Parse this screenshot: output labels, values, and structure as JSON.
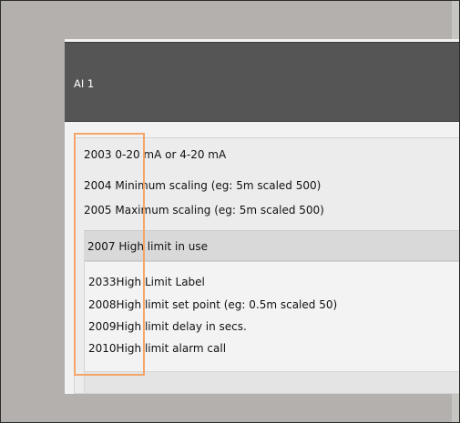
{
  "panel": {
    "title": "AI 1"
  },
  "settings": [
    {
      "code": "2003",
      "label": "0-20 mA or 4-20 mA"
    },
    {
      "code": "2004",
      "label": "Minimum scaling (eg: 5m scaled 500)"
    },
    {
      "code": "2005",
      "label": "Maximum scaling (eg: 5m scaled 500)"
    }
  ],
  "high_limit_group": {
    "header": {
      "code": "2007",
      "label": "High limit in use"
    },
    "items": [
      {
        "code": "2033",
        "label": "High Limit Label"
      },
      {
        "code": "2008",
        "label": "High limit set point (eg: 0.5m scaled 50)"
      },
      {
        "code": "2009",
        "label": "High limit delay in secs."
      },
      {
        "code": "2010",
        "label": "High limit alarm call"
      }
    ]
  },
  "colors": {
    "header_bg": "#555555",
    "highlight_border": "#f3a56a",
    "outer_bg": "#b3b0ad"
  }
}
